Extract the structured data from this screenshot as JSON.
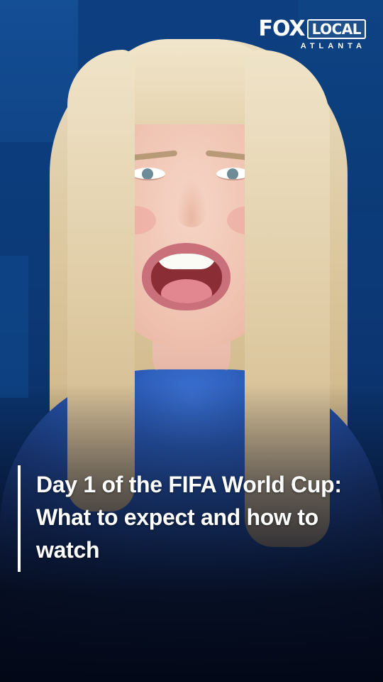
{
  "brand": {
    "logo_main": "FOX",
    "logo_badge": "LOCAL",
    "logo_sub": "ATLANTA"
  },
  "story": {
    "headline": "Day 1 of the FIFA World Cup: What to expect and how to watch"
  },
  "colors": {
    "background": "#0c3a78",
    "text": "#ffffff",
    "accent_bar": "#ffffff"
  }
}
